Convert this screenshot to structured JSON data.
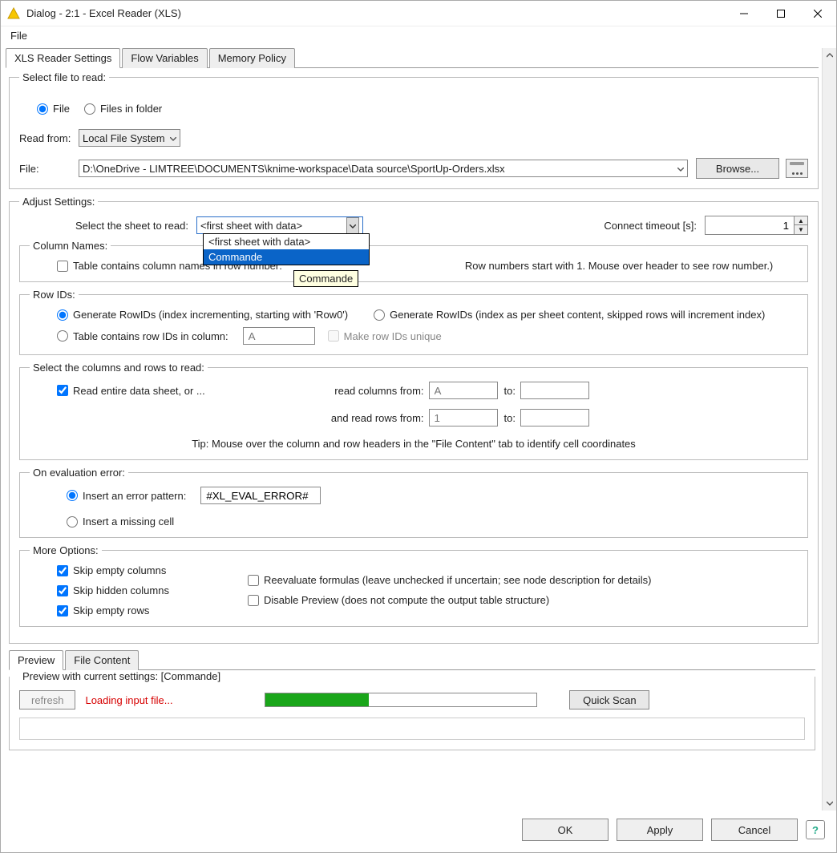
{
  "window": {
    "title": "Dialog - 2:1 - Excel Reader (XLS)"
  },
  "menu": {
    "file": "File"
  },
  "tabs": {
    "settings": "XLS Reader Settings",
    "flowvars": "Flow Variables",
    "memory": "Memory Policy"
  },
  "selectFile": {
    "legend": "Select file to read:",
    "radio_file": "File",
    "radio_folder": "Files in folder",
    "read_from": "Read from:",
    "read_from_value": "Local File System",
    "file_label": "File:",
    "file_path": "D:\\OneDrive - LIMTREE\\DOCUMENTS\\knime-workspace\\Data source\\SportUp-Orders.xlsx",
    "browse": "Browse..."
  },
  "adjust": {
    "legend": "Adjust Settings:",
    "select_sheet": "Select the sheet to read:",
    "sheet_selected": "<first sheet with data>",
    "sheet_options": {
      "first": "<first sheet with data>",
      "commande": "Commande"
    },
    "tooltip": "Commande",
    "timeout_label": "Connect timeout [s]:",
    "timeout_value": "1"
  },
  "colnames": {
    "legend": "Column Names:",
    "check": "Table contains column names in row number:",
    "hint_tail": "Row numbers start with 1. Mouse over header to see row number.)"
  },
  "rowids": {
    "legend": "Row IDs:",
    "r1": "Generate RowIDs (index incrementing, starting with 'Row0')",
    "r2": "Generate RowIDs (index as per sheet content, skipped rows will increment index)",
    "r3": "Table contains row IDs in column:",
    "col_placeholder": "A",
    "unique": "Make row IDs unique"
  },
  "range": {
    "legend": "Select the columns and rows to read:",
    "check": "Read entire data sheet, or ...",
    "readcols": "read columns from:",
    "readrows": "and read rows from:",
    "to": "to:",
    "col_from": "A",
    "row_from": "1",
    "tip": "Tip: Mouse over the column and row headers in the \"File Content\" tab to identify cell coordinates"
  },
  "evalerr": {
    "legend": "On evaluation error:",
    "r1": "Insert an error pattern:",
    "pattern": "#XL_EVAL_ERROR#",
    "r2": "Insert a missing cell"
  },
  "more": {
    "legend": "More Options:",
    "c1": "Skip empty columns",
    "c2": "Skip hidden columns",
    "c3": "Skip empty rows",
    "c4": "Reevaluate formulas (leave unchecked if uncertain; see node description for details)",
    "c5": "Disable Preview  (does not compute the output table structure)"
  },
  "previewTabs": {
    "preview": "Preview",
    "filecontent": "File Content"
  },
  "preview": {
    "legend": "Preview with current settings: [Commande]",
    "refresh": "refresh",
    "loading": "Loading input file...",
    "quickscan": "Quick Scan",
    "progress_pct": 38
  },
  "footer": {
    "ok": "OK",
    "apply": "Apply",
    "cancel": "Cancel",
    "help": "?"
  }
}
